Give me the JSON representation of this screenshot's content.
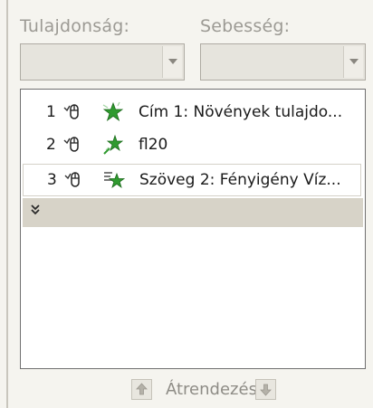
{
  "fields": {
    "property_label": "Tulajdonság:",
    "speed_label": "Sebesség:",
    "property_value": "",
    "speed_value": ""
  },
  "animation_list": {
    "items": [
      {
        "number": "1",
        "text": "Cím 1: Növények tulajdo..."
      },
      {
        "number": "2",
        "text": "fl20"
      },
      {
        "number": "3",
        "text": "Szöveg 2: Fényigény Víz..."
      }
    ],
    "expand_icon": "»"
  },
  "reorder": {
    "label": "Átrendezés"
  },
  "colors": {
    "panel_background": "#f5f4ef",
    "star_green": "#2f9a2f",
    "expand_bar": "#d7d3c8"
  },
  "icons": {
    "row_mouse": "mouse-click-icon",
    "row_star": "entrance-effect-star-icon",
    "dropdown": "chevron-down-icon",
    "move_up": "arrow-up-icon",
    "move_down": "arrow-down-icon",
    "expand": "double-chevron-down-icon"
  }
}
